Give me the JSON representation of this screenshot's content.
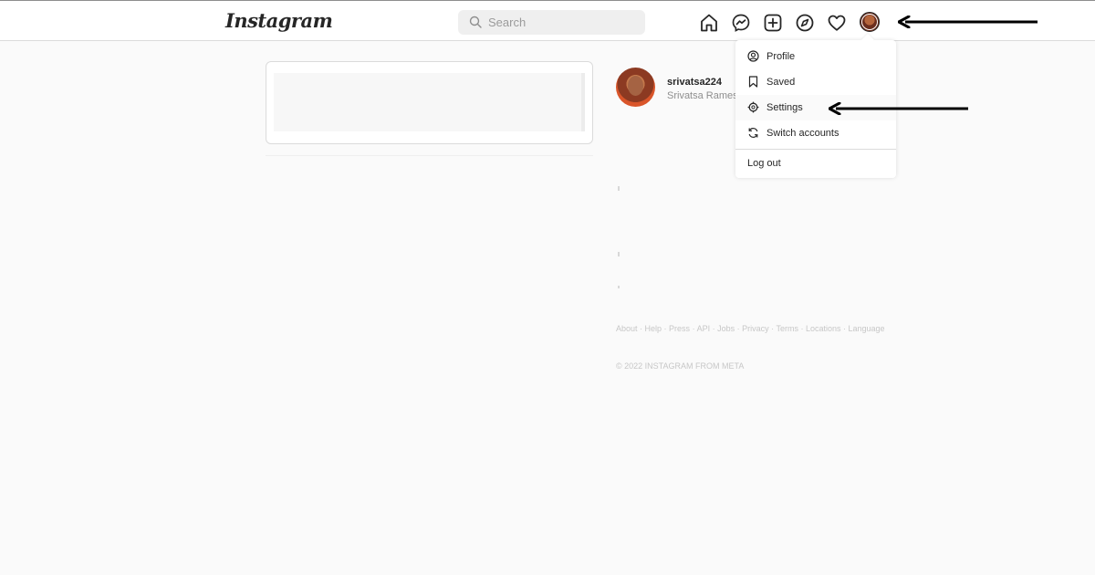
{
  "app": {
    "logo_text": "Instagram"
  },
  "search": {
    "placeholder": "Search"
  },
  "nav": {
    "icons": [
      "home-icon",
      "messenger-icon",
      "new-post-icon",
      "explore-icon",
      "activity-heart-icon",
      "profile-avatar"
    ]
  },
  "sidebar": {
    "username": "srivatsa224",
    "full_name": "Srivatsa Ramesh"
  },
  "dropdown": {
    "items": [
      {
        "label": "Profile",
        "icon": "profile-circle-icon"
      },
      {
        "label": "Saved",
        "icon": "bookmark-icon"
      },
      {
        "label": "Settings",
        "icon": "gear-icon"
      },
      {
        "label": "Switch accounts",
        "icon": "switch-arrows-icon"
      }
    ],
    "logout_label": "Log out"
  },
  "footer": {
    "links": [
      "About",
      "Help",
      "Press",
      "API",
      "Jobs",
      "Privacy",
      "Terms",
      "Locations",
      "Language"
    ],
    "separator": " · ",
    "copyright": "© 2022 INSTAGRAM FROM META"
  },
  "colors": {
    "background": "#fafafa",
    "surface": "#ffffff",
    "text": "#262626",
    "muted": "#8e8e8e",
    "border": "#dbdbdb",
    "arrow": "#000000"
  }
}
